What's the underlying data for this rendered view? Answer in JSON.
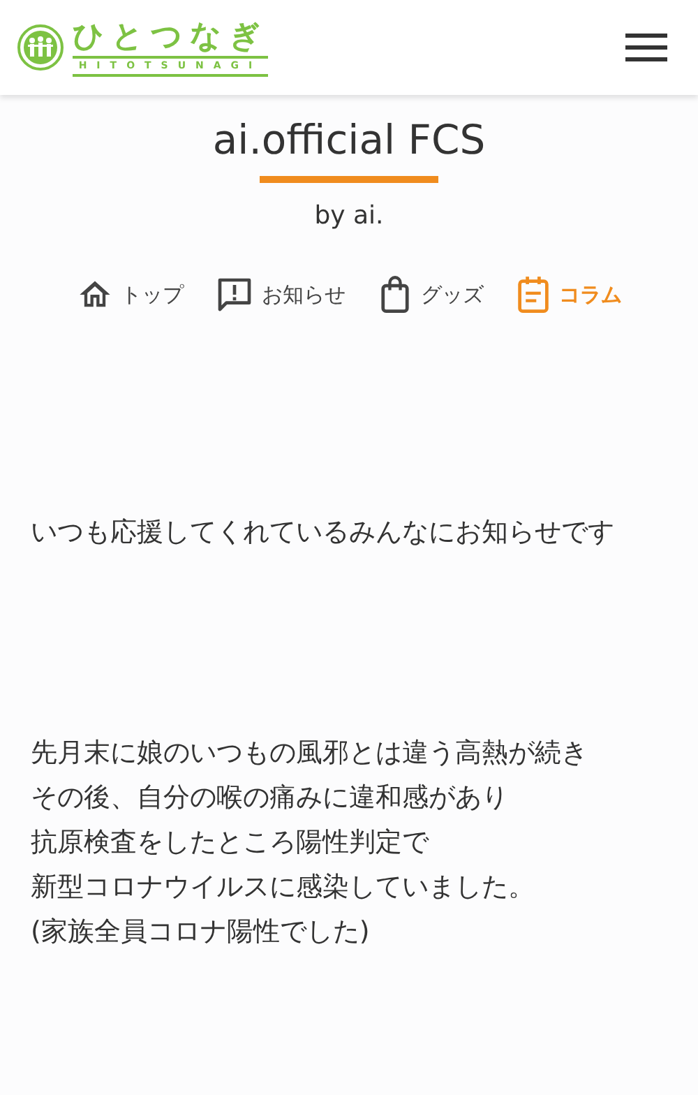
{
  "header": {
    "logo_text": "ひとつなぎ",
    "logo_subtext": "HITOTSUNAGI"
  },
  "title": "ai.official FCS",
  "byline": "by ai.",
  "tabs": [
    {
      "kind": "home",
      "label": "トップ",
      "selected": false
    },
    {
      "kind": "notice",
      "label": "お知らせ",
      "selected": false
    },
    {
      "kind": "bag",
      "label": "グッズ",
      "selected": false
    },
    {
      "kind": "column",
      "label": "コラム",
      "selected": true
    }
  ],
  "paragraphs": [
    [
      "いつも応援してくれているみんなにお知らせです"
    ],
    [
      "先月末に娘のいつもの風邪とは違う高熱が続き",
      "その後、自分の喉の痛みに違和感があり",
      "抗原検査をしたところ陽性判定で",
      "新型コロナウイルスに感染していました。",
      "(家族全員コロナ陽性でした)"
    ]
  ]
}
